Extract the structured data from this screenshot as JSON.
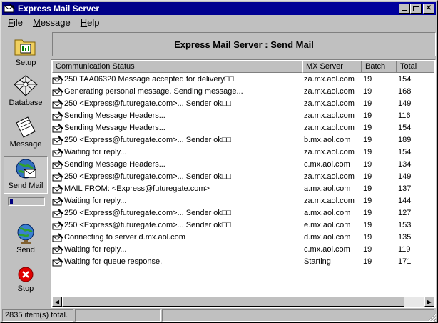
{
  "window": {
    "title": "Express Mail Server"
  },
  "menu": [
    {
      "label": "File",
      "accel": "F",
      "rest": "ile"
    },
    {
      "label": "Message",
      "accel": "M",
      "rest": "essage"
    },
    {
      "label": "Help",
      "accel": "H",
      "rest": "elp"
    }
  ],
  "sidebar": {
    "setup": "Setup",
    "database": "Database",
    "message": "Message",
    "send_mail": "Send Mail",
    "send": "Send",
    "stop": "Stop"
  },
  "header": {
    "title": "Express Mail Server : Send Mail"
  },
  "columns": [
    "Communication Status",
    "MX Server",
    "Batch",
    "Total"
  ],
  "rows": [
    {
      "status": "250 TAA06320 Message accepted for delivery□□",
      "mx": "za.mx.aol.com",
      "batch": "19",
      "total": "154"
    },
    {
      "status": "Generating personal message. Sending message...",
      "mx": "za.mx.aol.com",
      "batch": "19",
      "total": "168"
    },
    {
      "status": "250 <Express@futuregate.com>... Sender ok□□",
      "mx": "za.mx.aol.com",
      "batch": "19",
      "total": "149"
    },
    {
      "status": "Sending Message Headers...",
      "mx": "za.mx.aol.com",
      "batch": "19",
      "total": "116"
    },
    {
      "status": "Sending Message Headers...",
      "mx": "za.mx.aol.com",
      "batch": "19",
      "total": "154"
    },
    {
      "status": "250 <Express@futuregate.com>... Sender ok□□",
      "mx": "b.mx.aol.com",
      "batch": "19",
      "total": "189"
    },
    {
      "status": "Waiting for reply...",
      "mx": "za.mx.aol.com",
      "batch": "19",
      "total": "154"
    },
    {
      "status": "Sending Message Headers...",
      "mx": "c.mx.aol.com",
      "batch": "19",
      "total": "134"
    },
    {
      "status": "250 <Express@futuregate.com>... Sender ok□□",
      "mx": "za.mx.aol.com",
      "batch": "19",
      "total": "149"
    },
    {
      "status": "MAIL FROM: <Express@futuregate.com>",
      "mx": "a.mx.aol.com",
      "batch": "19",
      "total": "137"
    },
    {
      "status": "Waiting for reply...",
      "mx": "za.mx.aol.com",
      "batch": "19",
      "total": "144"
    },
    {
      "status": "250 <Express@futuregate.com>... Sender ok□□",
      "mx": "a.mx.aol.com",
      "batch": "19",
      "total": "127"
    },
    {
      "status": "250 <Express@futuregate.com>... Sender ok□□",
      "mx": "e.mx.aol.com",
      "batch": "19",
      "total": "153"
    },
    {
      "status": "Connecting to server d.mx.aol.com",
      "mx": "d.mx.aol.com",
      "batch": "19",
      "total": "135"
    },
    {
      "status": "Waiting for reply...",
      "mx": "c.mx.aol.com",
      "batch": "19",
      "total": "119"
    },
    {
      "status": "Waiting for queue response.",
      "mx": "Starting",
      "batch": "19",
      "total": "171"
    }
  ],
  "statusbar": {
    "count": "2835 item(s) total."
  }
}
